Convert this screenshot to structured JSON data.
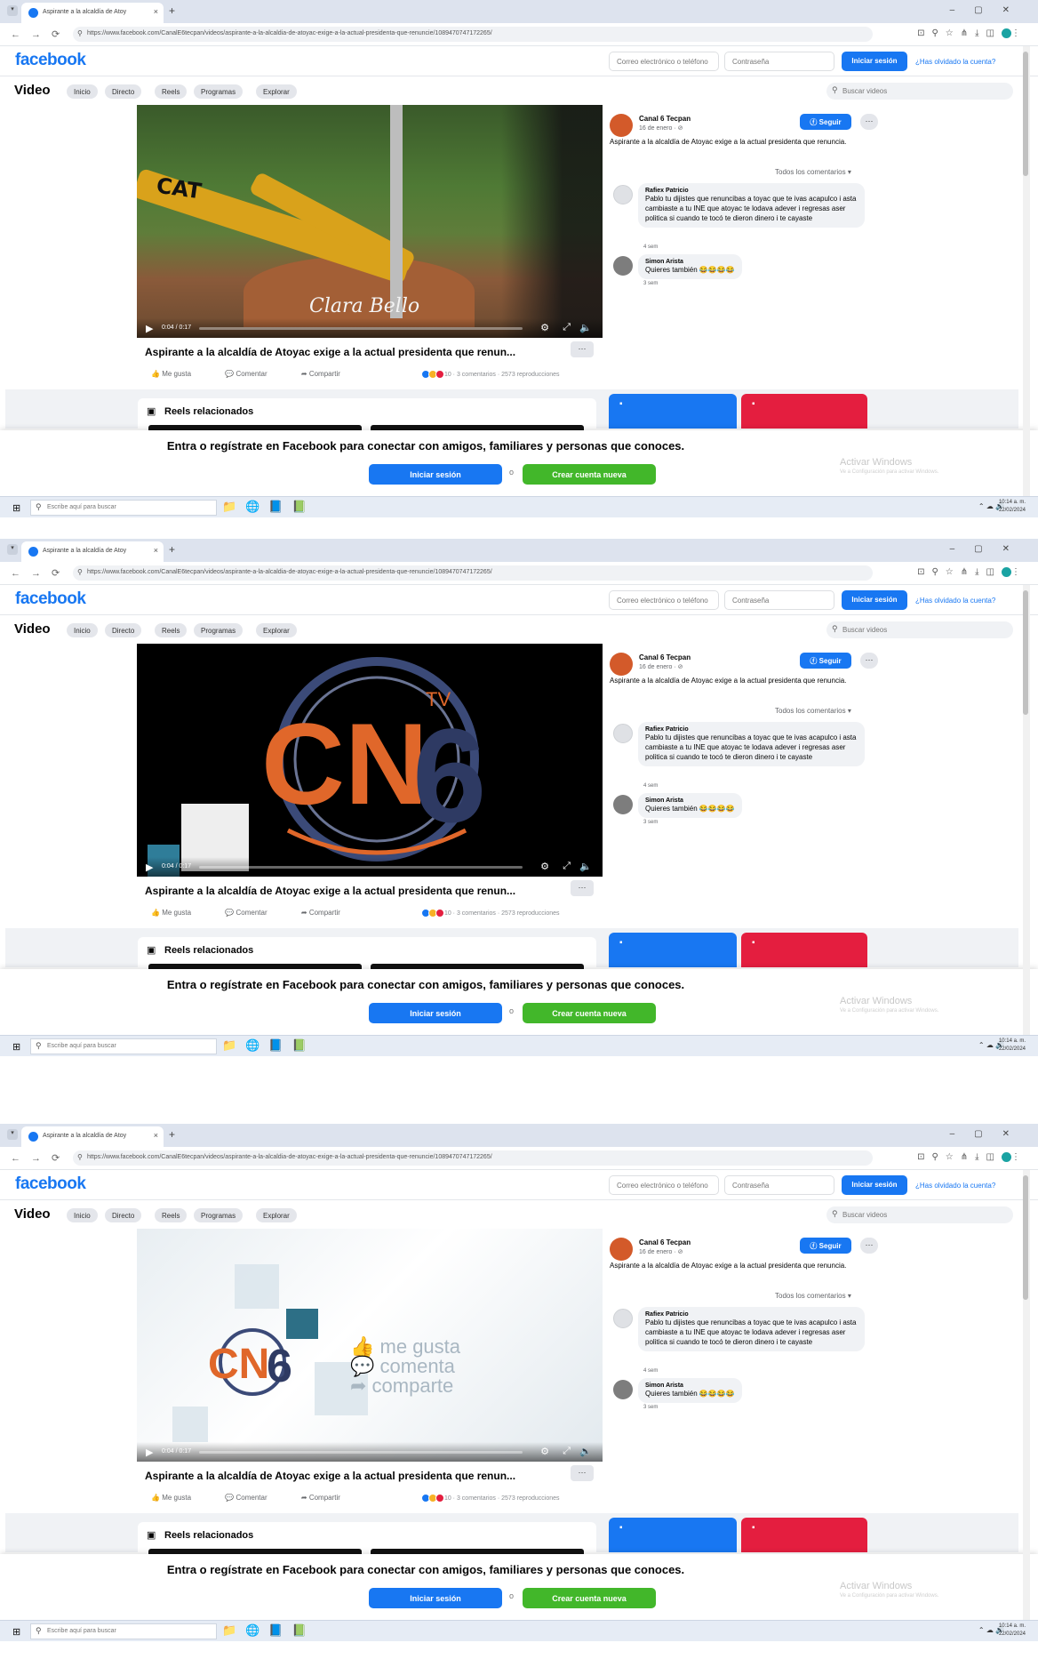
{
  "browser": {
    "tab_title": "Aspirante a la alcaldía de Atoy",
    "new_tab": "+",
    "url": "https://www.facebook.com/CanalE6tecpan/videos/aspirante-a-la-alcaldia-de-atoyac-exige-a-la-actual-presidenta-que-renuncie/1089470747172265/"
  },
  "header": {
    "logo": "facebook",
    "email_placeholder": "Correo electrónico o teléfono",
    "password_placeholder": "Contraseña",
    "login_label": "Iniciar sesión",
    "forgot_label": "¿Has olvidado la cuenta?"
  },
  "video_nav": {
    "title": "Video",
    "pills": [
      "Inicio",
      "Directo",
      "Reels",
      "Programas",
      "Explorar"
    ],
    "search_placeholder": "Buscar videos"
  },
  "post": {
    "title": "Aspirante a la alcaldía de Atoyac exige a la actual presidenta que renun...",
    "actions": [
      "Me gusta",
      "Comentar",
      "Compartir"
    ],
    "stats": "10 · 3 comentarios · 2573 reproducciones"
  },
  "sidebar": {
    "page_name": "Canal 6 Tecpan",
    "date": "16 de enero · ⊘",
    "follow_label": "Seguir",
    "description": "Aspirante a la alcaldía de Atoyac exige a la actual presidenta que renuncia.",
    "all_comments": "Todos los comentarios ▾",
    "comments": [
      {
        "name": "Rafiex Patricio",
        "text": "Pablo tu dijistes que renuncibas a toyac que te ivas acapulco i asta cambiaste a tu INE que atoyac te lodava adever i regresas aser politica si cuando te tocó te dieron dinero i te cayaste",
        "time": "4 sem"
      },
      {
        "name": "Simon Arista",
        "text": "Quieres también 😂😂😂😂",
        "time": "3 sem"
      }
    ]
  },
  "reels": {
    "label": "Reels relacionados"
  },
  "cta": {
    "text": "Entra o regístrate en Facebook para conectar con amigos, familiares y personas que conoces.",
    "login": "Iniciar sesión",
    "or": "o",
    "create": "Crear cuenta nueva"
  },
  "windows": {
    "activate": "Activar Windows",
    "activate_sub": "Ve a Configuración para activar Windows.",
    "search_placeholder": "Escribe aquí para buscar",
    "clock": [
      "10:14 a. m.",
      "22/02/2024"
    ]
  },
  "video_overlays": {
    "watermark": "Clara Bello",
    "share_lines": [
      "me gusta",
      "comenta",
      "comparte"
    ],
    "logo_text": "CN6",
    "logo_tv": "TV"
  },
  "colors": {
    "brand": "#1877f2",
    "create": "#42b72a",
    "red_card": "#e41e3f"
  }
}
